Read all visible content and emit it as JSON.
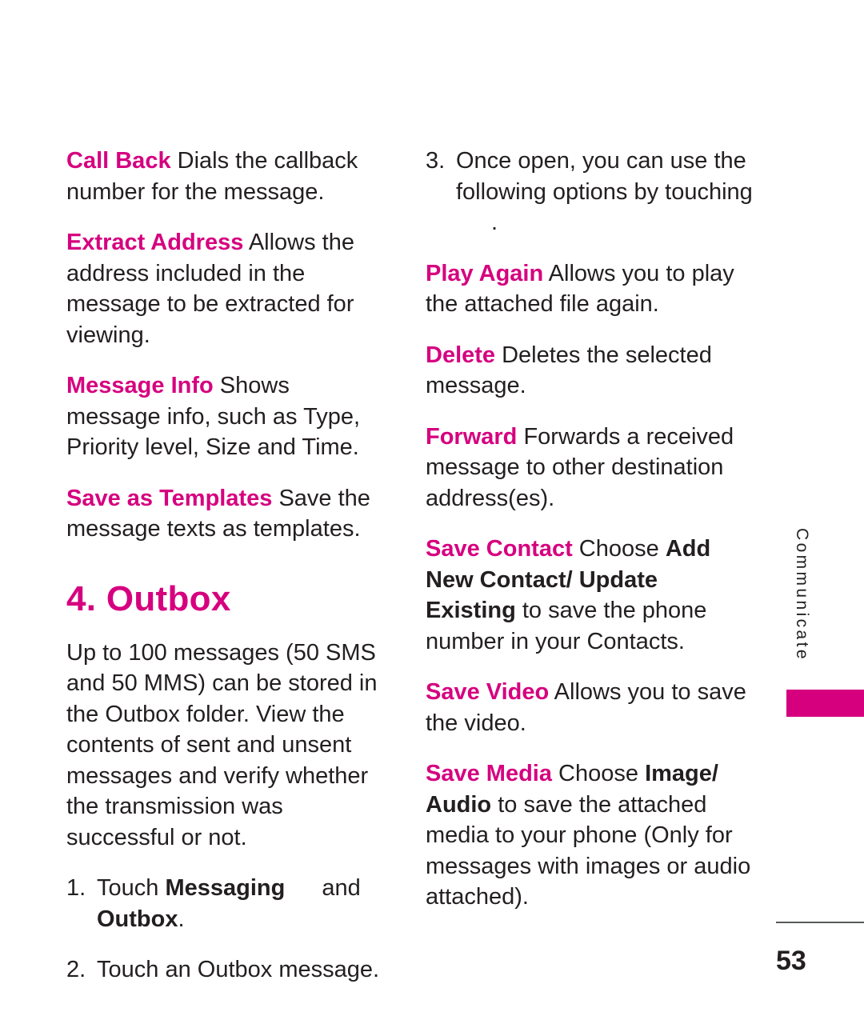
{
  "page": {
    "number": "53",
    "side_tab_label": "Communicate",
    "accent_color": "#d6007f",
    "text_color": "#231f20"
  },
  "left_column": {
    "entries": [
      {
        "term": "Call Back",
        "description": " Dials the callback number for the message."
      },
      {
        "term": "Extract Address",
        "description": " Allows the address included in the message to be extracted for viewing."
      },
      {
        "term": "Message Info",
        "description": " Shows message info, such as Type, Priority level, Size and Time."
      },
      {
        "term": "Save as Templates",
        "description": " Save the message texts as templates."
      }
    ],
    "heading": "4. Outbox",
    "intro": "Up to 100 messages (50 SMS and 50 MMS) can be stored in the Outbox folder. View the contents of sent and unsent messages and verify whether the transmission was successful or not.",
    "steps": [
      {
        "number": "1.",
        "text_before": "Touch ",
        "bold_1": "Messaging",
        "text_middle": "and ",
        "bold_2": "Outbox",
        "text_after": "."
      },
      {
        "number": "2.",
        "text_before": "Touch an Outbox message.",
        "bold_1": "",
        "text_middle": "",
        "bold_2": "",
        "text_after": ""
      }
    ]
  },
  "right_column": {
    "step3": {
      "number": "3.",
      "text": "Once open, you can use the following options by touching",
      "trailing": "."
    },
    "entries": [
      {
        "term": "Play Again",
        "description": " Allows you to play the attached file again.",
        "bold_1": "",
        "mid": "",
        "bold_2": "",
        "tail": ""
      },
      {
        "term": "Delete",
        "description": " Deletes the selected message.",
        "bold_1": "",
        "mid": "",
        "bold_2": "",
        "tail": ""
      },
      {
        "term": "Forward",
        "description": " Forwards a received message to other destination address(es).",
        "bold_1": "",
        "mid": "",
        "bold_2": "",
        "tail": ""
      },
      {
        "term": "Save Contact",
        "description": " Choose ",
        "bold_1": "Add New Contact/ Update Existing",
        "mid": " to save the phone number in your Contacts.",
        "bold_2": "",
        "tail": ""
      },
      {
        "term": "Save Video",
        "description": " Allows you to save the video.",
        "bold_1": "",
        "mid": "",
        "bold_2": "",
        "tail": ""
      },
      {
        "term": "Save Media",
        "description": " Choose ",
        "bold_1": "Image/ Audio",
        "mid": " to save the attached media to your phone (Only for messages with images or audio attached).",
        "bold_2": "",
        "tail": ""
      }
    ]
  }
}
